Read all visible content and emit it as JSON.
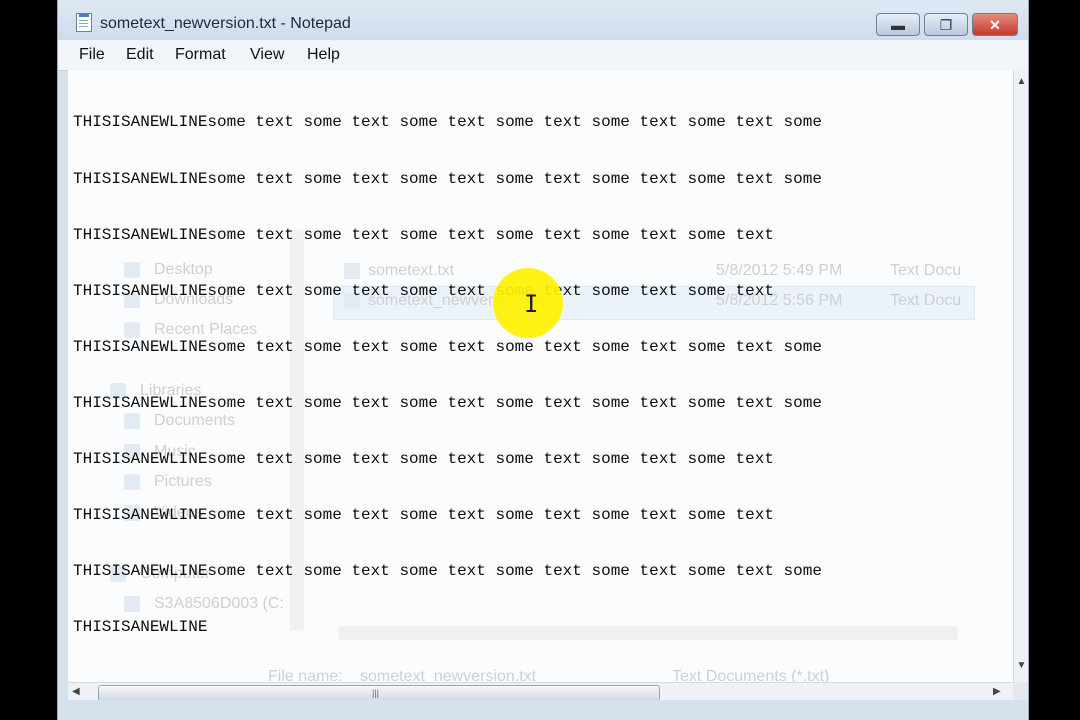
{
  "window": {
    "title": "sometext_newversion.txt - Notepad",
    "controls": {
      "minimize": "▬",
      "maximize": "❐",
      "close": "✕"
    }
  },
  "menu": {
    "file": "File",
    "edit": "Edit",
    "format": "Format",
    "view": "View",
    "help": "Help"
  },
  "editor": {
    "lines": [
      "THISISANEWLINEsome text some text some text some text some text some text some",
      "THISISANEWLINEsome text some text some text some text some text some text some",
      "THISISANEWLINEsome text some text some text some text some text some text",
      "THISISANEWLINEsome text some text some text some text some text some text",
      "THISISANEWLINEsome text some text some text some text some text some text some",
      "THISISANEWLINEsome text some text some text some text some text some text some",
      "THISISANEWLINEsome text some text some text some text some text some text",
      "THISISANEWLINEsome text some text some text some text some text some text",
      "THISISANEWLINEsome text some text some text some text some text some text some",
      "THISISANEWLINE"
    ]
  },
  "ghost_dialog": {
    "nav": {
      "desktop": "Desktop",
      "downloads": "Downloads",
      "recent_places": "Recent Places",
      "libraries": "Libraries",
      "documents": "Documents",
      "music": "Music",
      "pictures": "Pictures",
      "videos": "Videos",
      "computer": "Computer",
      "drive": "S3A8506D003 (C:"
    },
    "files": [
      {
        "name": "sometext.txt",
        "date": "5/8/2012 5:49 PM",
        "type": "Text Docu"
      },
      {
        "name": "sometext_newversion.txt",
        "date": "5/8/2012 5:56 PM",
        "type": "Text Docu"
      }
    ],
    "file_name_label": "File name:",
    "file_name_value": "sometext_newversion.txt",
    "file_type_value": "Text Documents (*.txt)"
  },
  "colors": {
    "cursor_highlight": "#fff200",
    "window_frame": "#d6e1ee"
  },
  "icons": {
    "cursor": "ibeam-cursor-icon",
    "app": "notepad-icon"
  }
}
